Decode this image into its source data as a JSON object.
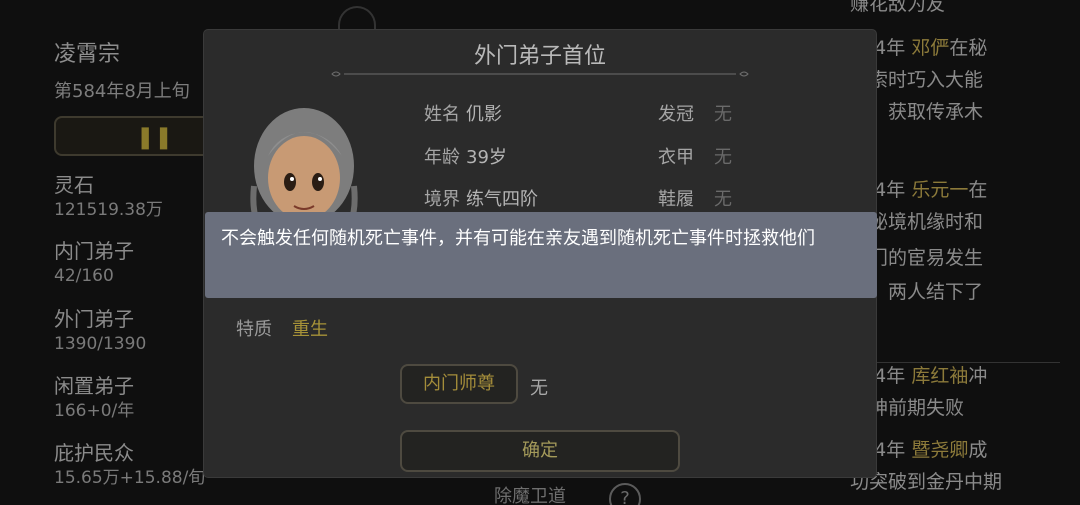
{
  "background": {
    "sect_name": "凌霄宗",
    "date": "第584年8月上旬",
    "speed_icon": "pause-icon",
    "stats": [
      {
        "label": "灵石",
        "value": "121519.38万"
      },
      {
        "label": "内门弟子",
        "value": "42/160"
      },
      {
        "label": "外门弟子",
        "value": "1390/1390"
      },
      {
        "label": "闲置弟子",
        "value": "166+0/年"
      },
      {
        "label": "庇护民众",
        "value": "15.65万+15.88/旬"
      }
    ],
    "log_top_cut": "赚花敌为友",
    "logs": [
      {
        "year": "584年",
        "name": "邓俨",
        "lines": [
          "在秘",
          "探索时巧入大能",
          "府，获取传承木",
          "通"
        ]
      },
      {
        "year": "584年",
        "name": "乐元一",
        "lines": [
          "在",
          "夺秘境机缘时和",
          "音门的宦易发生",
          "突，两人结下了",
          "怨"
        ]
      },
      {
        "year": "584年",
        "name": "库红袖",
        "lines": [
          "冲",
          "分神前期失败"
        ]
      },
      {
        "year": "584年",
        "name": "暨尧卿",
        "lines": [
          "成",
          "功突破到金丹中期"
        ]
      }
    ],
    "bottom_label": "除魔卫道",
    "help_icon": "?"
  },
  "modal": {
    "title": "外门弟子首位",
    "name_label": "姓名",
    "name_value": "仉影",
    "age_label": "年龄",
    "age_value": "39岁",
    "realm_label": "境界",
    "realm_value": "练气四阶",
    "hair_label": "发冠",
    "hair_value": "无",
    "armor_label": "衣甲",
    "armor_value": "无",
    "shoe_label": "鞋履",
    "shoe_value": "无",
    "trait_label": "特质",
    "trait_value": "重生",
    "master_button": "内门师尊",
    "master_value": "无",
    "confirm_button": "确定"
  },
  "tooltip": {
    "text": "不会触发任何随机死亡事件，并有可能在亲友遇到随机死亡事件时拯救他们"
  },
  "colors": {
    "tooltip_bg": "#6a6f7d",
    "accent_gold": "#a69238",
    "modal_bg": "#2b2b2b"
  }
}
